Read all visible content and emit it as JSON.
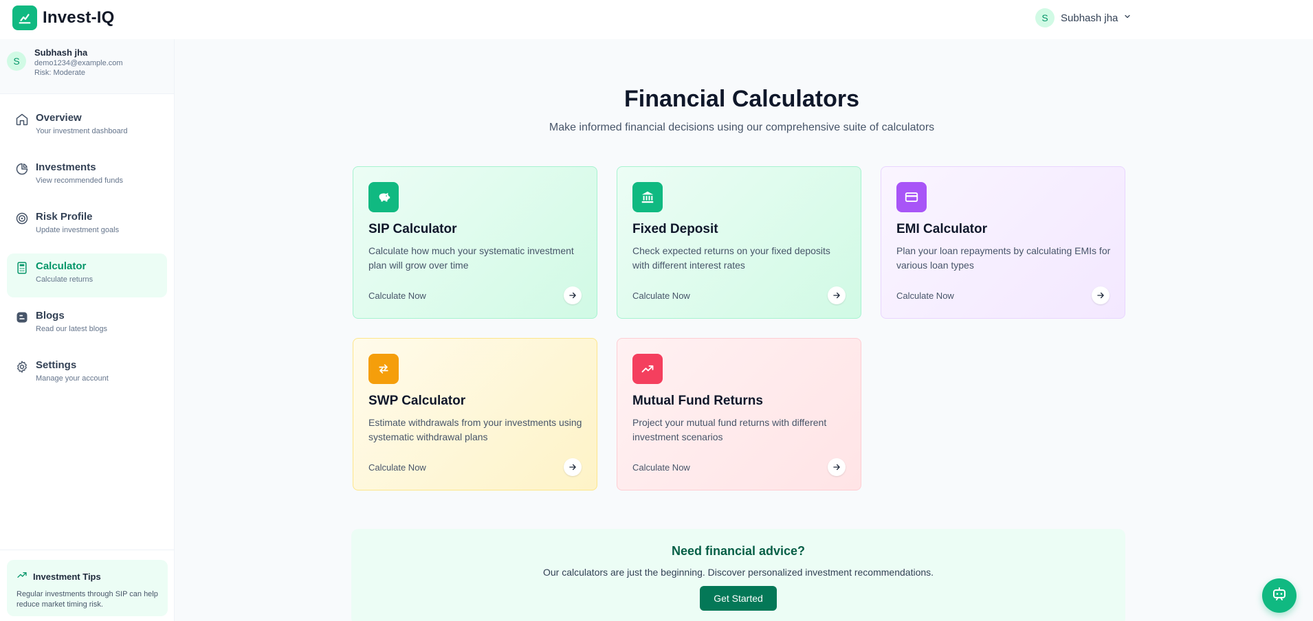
{
  "app": {
    "name": "Invest-IQ",
    "brand_color": "#10b981"
  },
  "header": {
    "user_initial": "S",
    "user_name": "Subhash jha",
    "menu_icon": "chevron-down-icon"
  },
  "sidebar": {
    "profile": {
      "initial": "S",
      "name": "Subhash jha",
      "email": "demo1234@example.com",
      "risk": "Risk: Moderate"
    },
    "items": [
      {
        "label": "Overview",
        "sub": "Your investment dashboard",
        "icon": "home-icon",
        "active": false
      },
      {
        "label": "Investments",
        "sub": "View recommended funds",
        "icon": "pie-chart-icon",
        "active": false
      },
      {
        "label": "Risk Profile",
        "sub": "Update investment goals",
        "icon": "target-icon",
        "active": false
      },
      {
        "label": "Calculator",
        "sub": "Calculate returns",
        "icon": "calculator-icon",
        "active": true
      },
      {
        "label": "Blogs",
        "sub": "Read our latest blogs",
        "icon": "blog-icon",
        "active": false
      },
      {
        "label": "Settings",
        "sub": "Manage your account",
        "icon": "gear-icon",
        "active": false
      }
    ],
    "tips": {
      "title": "Investment Tips",
      "text": "Regular investments through SIP can help reduce market timing risk."
    }
  },
  "main": {
    "title": "Financial Calculators",
    "subtitle": "Make informed financial decisions using our comprehensive suite of calculators",
    "cards": [
      {
        "title": "SIP Calculator",
        "desc": "Calculate how much your systematic investment plan will grow over time",
        "cta": "Calculate Now",
        "icon": "piggy-bank-icon",
        "icon_color": "#10b981"
      },
      {
        "title": "Fixed Deposit",
        "desc": "Check expected returns on your fixed deposits with different interest rates",
        "cta": "Calculate Now",
        "icon": "bank-icon",
        "icon_color": "#10b981"
      },
      {
        "title": "EMI Calculator",
        "desc": "Plan your loan repayments by calculating EMIs for various loan types",
        "cta": "Calculate Now",
        "icon": "credit-card-icon",
        "icon_color": "#a855f7"
      },
      {
        "title": "SWP Calculator",
        "desc": "Estimate withdrawals from your investments using systematic withdrawal plans",
        "cta": "Calculate Now",
        "icon": "swap-icon",
        "icon_color": "#f59e0b"
      },
      {
        "title": "Mutual Fund Returns",
        "desc": "Project your mutual fund returns with different investment scenarios",
        "cta": "Calculate Now",
        "icon": "trending-up-icon",
        "icon_color": "#f43f5e"
      }
    ],
    "advice": {
      "title": "Need financial advice?",
      "text": "Our calculators are just the beginning. Discover personalized investment recommendations.",
      "button": "Get Started"
    }
  },
  "chat_fab_icon": "chatbot-icon"
}
